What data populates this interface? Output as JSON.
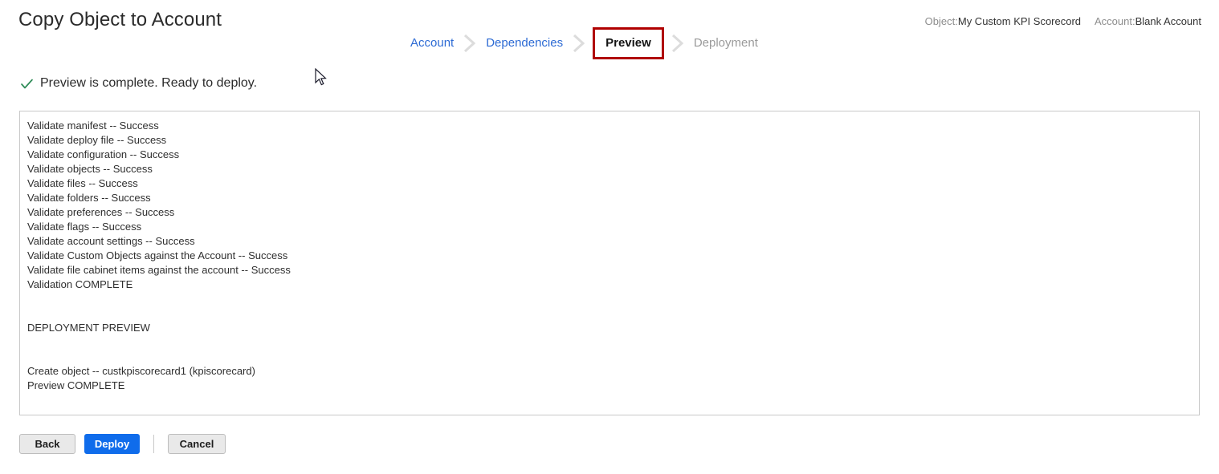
{
  "header": {
    "title": "Copy Object to Account"
  },
  "stepper": {
    "steps": [
      {
        "label": "Account",
        "state": "done"
      },
      {
        "label": "Dependencies",
        "state": "done"
      },
      {
        "label": "Preview",
        "state": "current"
      },
      {
        "label": "Deployment",
        "state": "pending"
      }
    ],
    "current_border_color": "#b00000",
    "link_color": "#2d6bd4",
    "pending_color": "#9a9a9a",
    "separator_icon": "chevron-right-icon"
  },
  "meta": [
    {
      "label": "Object:",
      "value": "My Custom KPI Scorecord"
    },
    {
      "label": "Account:",
      "value": "Blank Account"
    }
  ],
  "status": {
    "icon": "check-icon",
    "icon_color": "#2e8b57",
    "text": "Preview is complete. Ready to deploy."
  },
  "log": {
    "lines": [
      "Validate manifest -- Success",
      "Validate deploy file -- Success",
      "Validate configuration -- Success",
      "Validate objects -- Success",
      "Validate files -- Success",
      "Validate folders -- Success",
      "Validate preferences -- Success",
      "Validate flags -- Success",
      "Validate account settings -- Success",
      "Validate Custom Objects against the Account -- Success",
      "Validate file cabinet items against the account -- Success",
      "Validation COMPLETE",
      "",
      "",
      "DEPLOYMENT PREVIEW",
      "",
      "",
      "Create object -- custkpiscorecard1 (kpiscorecard)",
      "Preview COMPLETE"
    ]
  },
  "footer": {
    "back_label": "Back",
    "deploy_label": "Deploy",
    "cancel_label": "Cancel",
    "deploy_color": "#0f6ceb"
  }
}
